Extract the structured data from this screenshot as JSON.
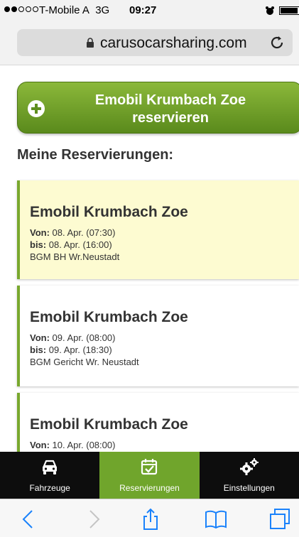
{
  "status_bar": {
    "carrier": "T-Mobile A",
    "network": "3G",
    "time": "09:27"
  },
  "browser": {
    "url": "carusocarsharing.com"
  },
  "reserve_button": {
    "label": "Emobil Krumbach Zoe\nreservieren"
  },
  "section_heading": "Meine Reservierungen:",
  "labels": {
    "from": "Von:",
    "until": "bis:"
  },
  "reservations": [
    {
      "title": "Emobil Krumbach Zoe",
      "from": "08. Apr. (07:30)",
      "until": "08. Apr. (16:00)",
      "location": "BGM BH Wr.Neustadt",
      "highlighted": true
    },
    {
      "title": "Emobil Krumbach Zoe",
      "from": "09. Apr. (08:00)",
      "until": "09. Apr. (18:30)",
      "location": "BGM Gericht Wr. Neustadt",
      "highlighted": false
    },
    {
      "title": "Emobil Krumbach Zoe",
      "from": "10. Apr. (08:00)",
      "until": "",
      "location": "",
      "highlighted": false
    }
  ],
  "tabs": [
    {
      "label": "Fahrzeuge",
      "icon": "car-icon",
      "active": false
    },
    {
      "label": "Reservierungen",
      "icon": "calendar-check-icon",
      "active": true
    },
    {
      "label": "Einstellungen",
      "icon": "gears-icon",
      "active": false
    }
  ],
  "colors": {
    "accent_green": "#70a52c",
    "highlight_bg": "#fdfbd1",
    "safari_blue": "#1a82fb"
  }
}
